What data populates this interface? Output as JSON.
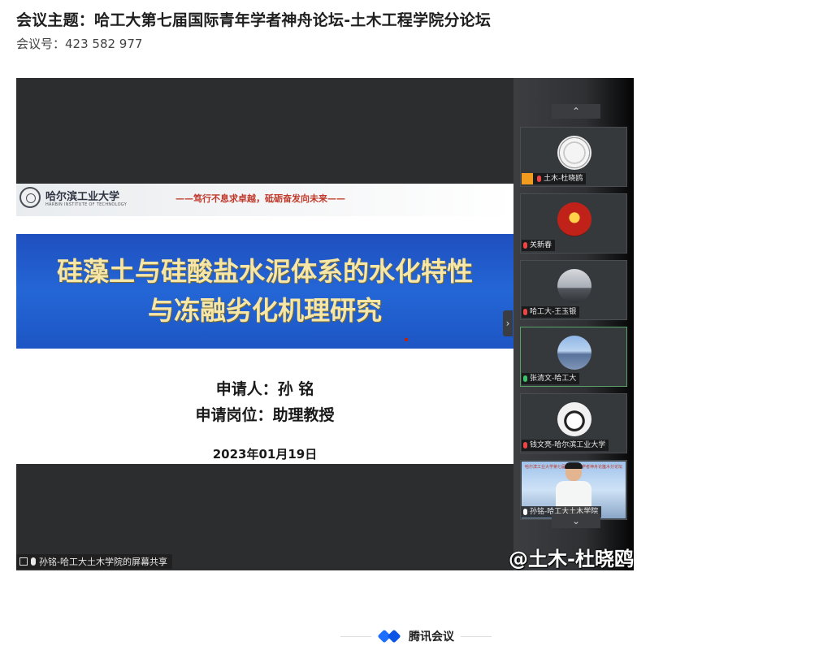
{
  "meeting": {
    "title": "会议主题：哈工大第七届国际青年学者神舟论坛-土木工程学院分论坛",
    "id_line": "会议号：423 582 977"
  },
  "slide": {
    "university_cn": "哈尔滨工业大学",
    "university_en": "HARBIN INSTITUTE OF TECHNOLOGY",
    "motto": "——笃行不息求卓越，砥砺奋发向未来——",
    "title_line1": "硅藻土与硅酸盐水泥体系的水化特性",
    "title_line2": "与冻融劣化机理研究",
    "applicant": "申请人：孙 铭",
    "position": "申请岗位：助理教授",
    "date": "2023年01月19日"
  },
  "share_bar": {
    "label": "孙铭-哈工大土木学院的屏幕共享"
  },
  "watermark": "@土木-杜晓鸥",
  "participants": [
    {
      "name": "土木-杜晓鸥",
      "avatar": "seal",
      "mic": "red",
      "host": true
    },
    {
      "name": "关新春",
      "avatar": "red",
      "mic": "red",
      "host": false
    },
    {
      "name": "哈工大-王玉银",
      "avatar": "sunset",
      "mic": "red",
      "host": false
    },
    {
      "name": "张清文-哈工大",
      "avatar": "lake",
      "mic": "green",
      "host": false,
      "active": true
    },
    {
      "name": "钱文亮-哈尔滨工业大学",
      "avatar": "panda",
      "mic": "red",
      "host": false
    },
    {
      "name": "孙铭-哈工大土木学院",
      "avatar": "video",
      "mic": "white",
      "host": false
    }
  ],
  "tile_poster": {
    "left": "哈尔滨工业大学第七届国际青年学者神舟论坛",
    "right": "土木分论坛"
  },
  "controls": {
    "scroll_up": "⌃",
    "scroll_down": "⌄",
    "collapse": "›"
  },
  "footer": {
    "brand": "腾讯会议"
  },
  "colors": {
    "slide_band": "#2466d6",
    "title_gold": "#f6e7a8",
    "host_badge": "#f29c1f",
    "brand_blue": "#1f6fff"
  }
}
